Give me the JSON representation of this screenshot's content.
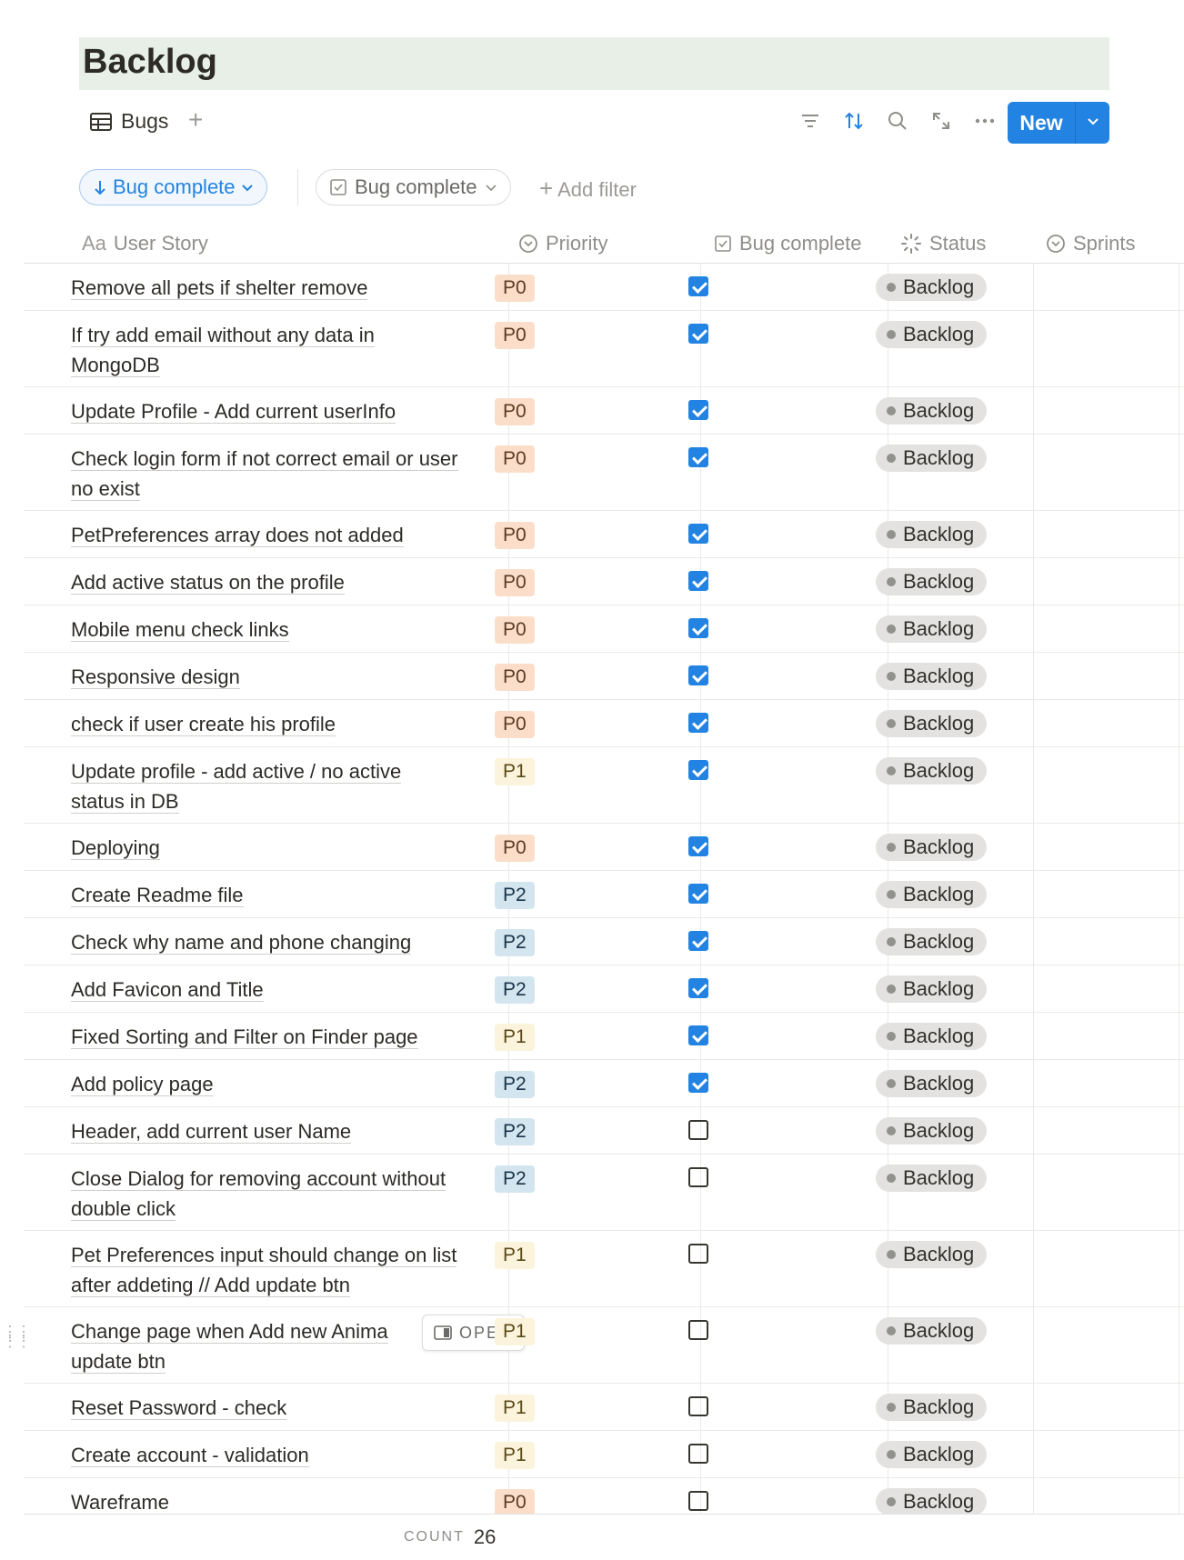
{
  "page": {
    "title": "Backlog"
  },
  "toolbar": {
    "view_name": "Bugs",
    "add_view": "+",
    "new_label": "New"
  },
  "filters": {
    "sort_chip": "Bug complete",
    "filter_chip": "Bug complete",
    "add_filter": "Add filter"
  },
  "columns": {
    "story": "User Story",
    "story_prefix": "Aa",
    "priority": "Priority",
    "bug_complete": "Bug complete",
    "status": "Status",
    "sprints": "Sprints"
  },
  "open_label": "OPEN",
  "rows": [
    {
      "lines": [
        "Remove all pets if shelter remove"
      ],
      "priority": "P0",
      "done": true,
      "status": "Backlog"
    },
    {
      "lines": [
        "If try add email without any data in",
        "MongoDB"
      ],
      "priority": "P0",
      "done": true,
      "status": "Backlog"
    },
    {
      "lines": [
        "Update Profile - Add current userInfo"
      ],
      "priority": "P0",
      "done": true,
      "status": "Backlog"
    },
    {
      "lines": [
        "Check login form if not correct email or user",
        "no exist"
      ],
      "priority": "P0",
      "done": true,
      "status": "Backlog"
    },
    {
      "lines": [
        "PetPreferences array does not added"
      ],
      "priority": "P0",
      "done": true,
      "status": "Backlog"
    },
    {
      "lines": [
        "Add active status on the profile"
      ],
      "priority": "P0",
      "done": true,
      "status": "Backlog"
    },
    {
      "lines": [
        "Mobile menu check links"
      ],
      "priority": "P0",
      "done": true,
      "status": "Backlog"
    },
    {
      "lines": [
        "Responsive design"
      ],
      "priority": "P0",
      "done": true,
      "status": "Backlog"
    },
    {
      "lines": [
        "check if user create his profile"
      ],
      "priority": "P0",
      "done": true,
      "status": "Backlog"
    },
    {
      "lines": [
        "Update profile - add active / no active",
        "status in DB"
      ],
      "priority": "P1",
      "done": true,
      "status": "Backlog"
    },
    {
      "lines": [
        "Deploying"
      ],
      "priority": "P0",
      "done": true,
      "status": "Backlog"
    },
    {
      "lines": [
        "Create Readme file"
      ],
      "priority": "P2",
      "done": true,
      "status": "Backlog"
    },
    {
      "lines": [
        "Check why name and phone changing"
      ],
      "priority": "P2",
      "done": true,
      "status": "Backlog"
    },
    {
      "lines": [
        "Add Favicon and Title"
      ],
      "priority": "P2",
      "done": true,
      "status": "Backlog"
    },
    {
      "lines": [
        "Fixed Sorting and Filter on Finder page"
      ],
      "priority": "P1",
      "done": true,
      "status": "Backlog"
    },
    {
      "lines": [
        "Add policy page"
      ],
      "priority": "P2",
      "done": true,
      "status": "Backlog"
    },
    {
      "lines": [
        "Header, add current user Name"
      ],
      "priority": "P2",
      "done": false,
      "status": "Backlog"
    },
    {
      "lines": [
        "Close Dialog for removing account without",
        "double click"
      ],
      "priority": "P2",
      "done": false,
      "status": "Backlog"
    },
    {
      "lines": [
        "Pet Preferences input should change on list",
        "after addeting // Add update btn"
      ],
      "priority": "P1",
      "done": false,
      "status": "Backlog"
    },
    {
      "lines": [
        "Change page when Add new Anima",
        "update btn"
      ],
      "priority": "P1",
      "done": false,
      "status": "Backlog",
      "hover": true
    },
    {
      "lines": [
        "Reset Password - check"
      ],
      "priority": "P1",
      "done": false,
      "status": "Backlog"
    },
    {
      "lines": [
        "Create account - validation"
      ],
      "priority": "P1",
      "done": false,
      "status": "Backlog"
    },
    {
      "lines": [
        "Wareframe"
      ],
      "priority": "P0",
      "done": false,
      "status": "Backlog"
    }
  ],
  "footer": {
    "count_label": "COUNT",
    "count_value": "26"
  }
}
